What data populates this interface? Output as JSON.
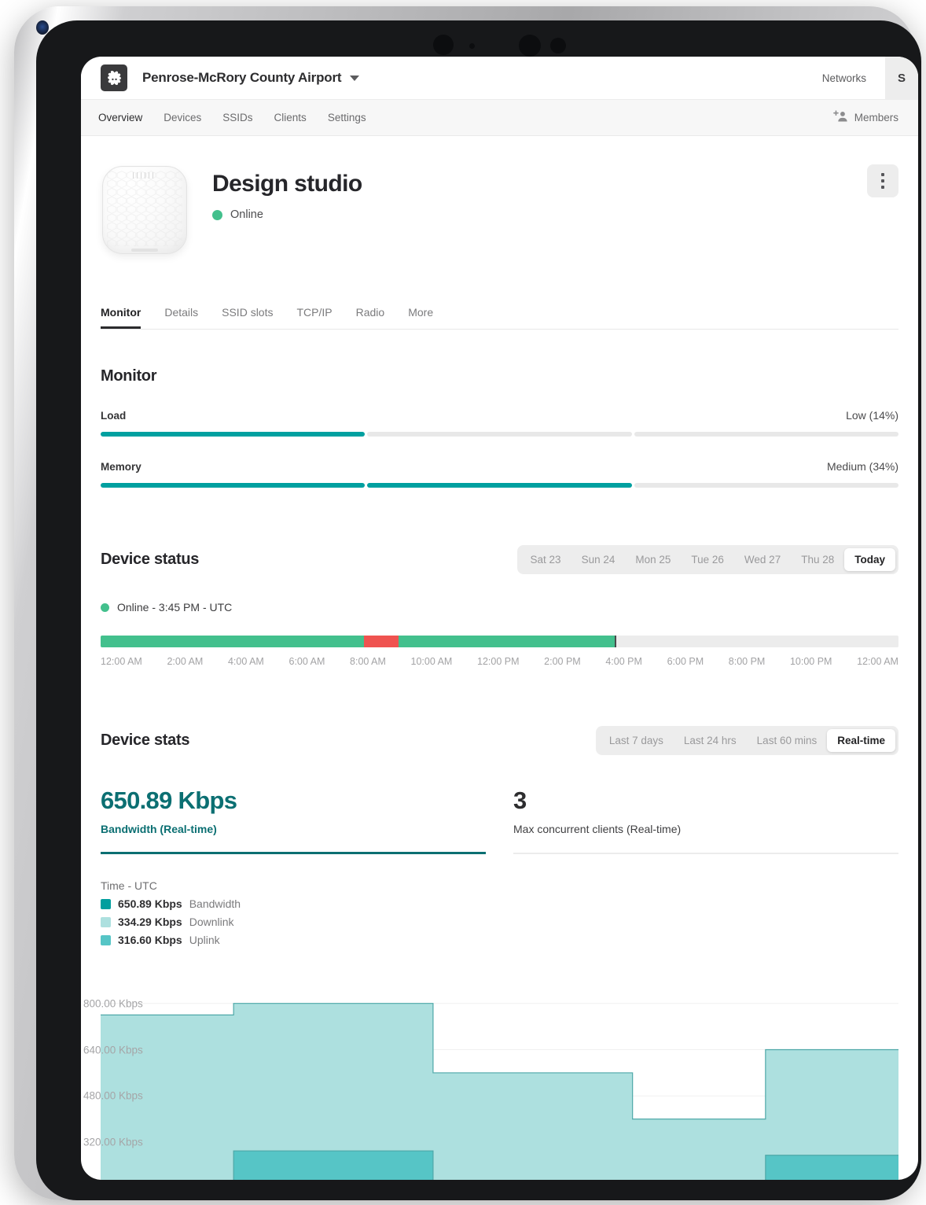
{
  "header": {
    "org_name": "Penrose-McRory County Airport",
    "networks_label": "Networks",
    "avatar_initial": "S",
    "logo_icon": "butterfly-logo-icon",
    "caret_icon": "chevron-down-icon"
  },
  "nav": {
    "items": [
      {
        "label": "Overview",
        "active": true
      },
      {
        "label": "Devices",
        "active": false
      },
      {
        "label": "SSIDs",
        "active": false
      },
      {
        "label": "Clients",
        "active": false
      },
      {
        "label": "Settings",
        "active": false
      }
    ],
    "members_label": "Members",
    "members_icon": "add-person-icon"
  },
  "device": {
    "title": "Design studio",
    "status": "Online",
    "status_color": "#43c08d",
    "image_icon": "access-point-device-image",
    "menu_icon": "kebab-menu-icon"
  },
  "section_tabs": [
    {
      "label": "Monitor",
      "active": true
    },
    {
      "label": "Details",
      "active": false
    },
    {
      "label": "SSID slots",
      "active": false
    },
    {
      "label": "TCP/IP",
      "active": false
    },
    {
      "label": "Radio",
      "active": false
    },
    {
      "label": "More",
      "active": false
    }
  ],
  "monitor": {
    "heading": "Monitor",
    "accent_color": "#00a0a0",
    "meters": [
      {
        "label": "Load",
        "value_text": "Low (14%)",
        "segments_on": 1,
        "segments_total": 3
      },
      {
        "label": "Memory",
        "value_text": "Medium (34%)",
        "segments_on": 2,
        "segments_total": 3
      }
    ]
  },
  "device_status": {
    "heading": "Device status",
    "days": [
      {
        "label": "Sat 23",
        "active": false
      },
      {
        "label": "Sun 24",
        "active": false
      },
      {
        "label": "Mon 25",
        "active": false
      },
      {
        "label": "Tue 26",
        "active": false
      },
      {
        "label": "Wed 27",
        "active": false
      },
      {
        "label": "Thu 28",
        "active": false
      },
      {
        "label": "Today",
        "active": true
      }
    ],
    "current_status": "Online - 3:45 PM - UTC",
    "online_color": "#43c08d",
    "offline_color": "#ef5350",
    "timeline_segments": [
      {
        "state": "online",
        "start_pct": 0,
        "width_pct": 33.0
      },
      {
        "state": "offline",
        "start_pct": 33.0,
        "width_pct": 4.3
      },
      {
        "state": "online",
        "start_pct": 37.3,
        "width_pct": 27.1
      }
    ],
    "marker_pct": 64.4,
    "ticks": [
      "12:00 AM",
      "2:00 AM",
      "4:00 AM",
      "6:00 AM",
      "8:00 AM",
      "10:00 AM",
      "12:00 PM",
      "2:00 PM",
      "4:00 PM",
      "6:00 PM",
      "8:00 PM",
      "10:00 PM",
      "12:00 AM"
    ]
  },
  "device_stats": {
    "heading": "Device stats",
    "ranges": [
      {
        "label": "Last 7 days",
        "active": false
      },
      {
        "label": "Last 24 hrs",
        "active": false
      },
      {
        "label": "Last 60 mins",
        "active": false
      },
      {
        "label": "Real-time",
        "active": true
      }
    ],
    "cards": [
      {
        "value": "650.89 Kbps",
        "label": "Bandwidth (Real-time)",
        "color": "#0b6f72"
      },
      {
        "value": "3",
        "label": "Max concurrent clients (Real-time)",
        "color": "#2d2d2f"
      }
    ],
    "tooltip": {
      "time_label": "Time - UTC",
      "rows": [
        {
          "value": "650.89 Kbps",
          "name": "Bandwidth",
          "color": "#009e9e"
        },
        {
          "value": "334.29 Kbps",
          "name": "Downlink",
          "color": "#ade0df"
        },
        {
          "value": "316.60 Kbps",
          "name": "Uplink",
          "color": "#56c5c6"
        }
      ]
    }
  },
  "chart_data": {
    "type": "area",
    "title": "Bandwidth (Real-time)",
    "xlabel": "Time - UTC",
    "ylabel": "Kbps",
    "grid": true,
    "legend_position": "top-left",
    "ytick_labels": [
      "800.00 Kbps",
      "640.00 Kbps",
      "480.00 Kbps",
      "320.00 Kbps"
    ],
    "ytick_values": [
      800,
      640,
      480,
      320
    ],
    "ylim": [
      160,
      840
    ],
    "x": [
      0,
      1,
      2,
      3,
      4,
      5,
      6,
      7,
      8,
      9,
      10,
      11
    ],
    "series": [
      {
        "name": "Downlink",
        "color": "#ade0df",
        "values": [
          760,
          760,
          800,
          800,
          800,
          560,
          560,
          560,
          400,
          400,
          640,
          640
        ]
      },
      {
        "name": "Uplink",
        "color": "#56c5c6",
        "values": [
          180,
          180,
          290,
          290,
          290,
          160,
          160,
          160,
          170,
          170,
          275,
          275
        ]
      }
    ]
  }
}
